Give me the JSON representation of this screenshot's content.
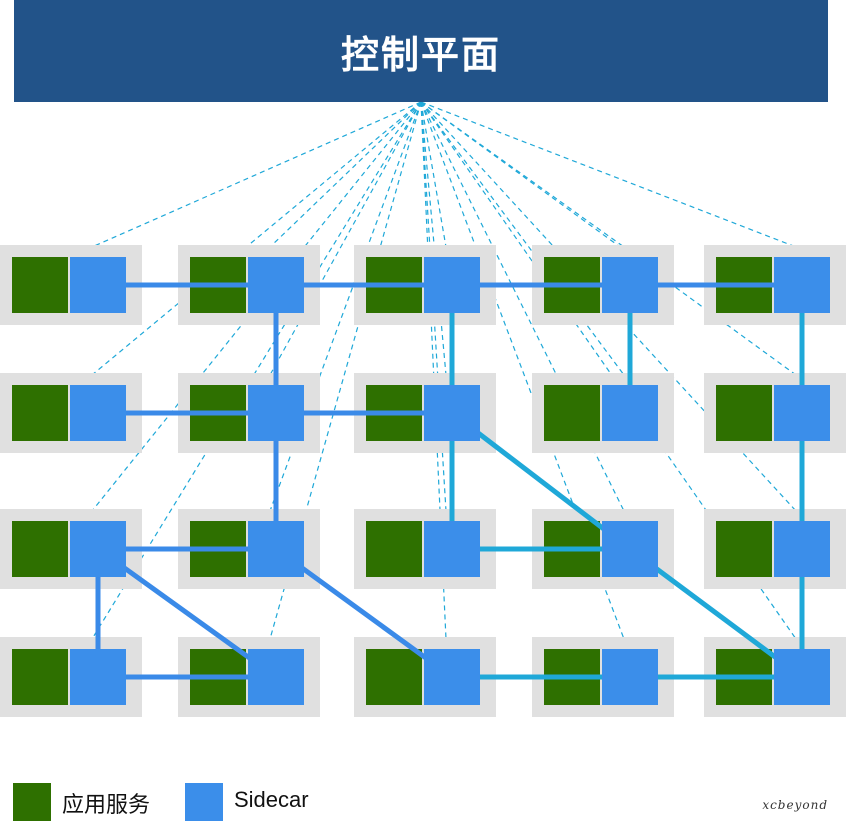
{
  "control_plane": {
    "label": "控制平面"
  },
  "colors": {
    "control_plane": "#225389",
    "app_service": "#2e7000",
    "sidecar": "#3b8eea",
    "node_bg": "#e0e0e0",
    "dark_link": "#3a8ae8",
    "teal_link": "#1fa8d8",
    "control_link": "#1fa8d8"
  },
  "grid": {
    "rows": 4,
    "cols": 5
  },
  "links": [
    {
      "from": [
        0,
        0
      ],
      "to": [
        0,
        1
      ],
      "style": "dark"
    },
    {
      "from": [
        0,
        1
      ],
      "to": [
        0,
        2
      ],
      "style": "dark"
    },
    {
      "from": [
        0,
        2
      ],
      "to": [
        0,
        3
      ],
      "style": "dark"
    },
    {
      "from": [
        0,
        3
      ],
      "to": [
        0,
        4
      ],
      "style": "dark"
    },
    {
      "from": [
        0,
        1
      ],
      "to": [
        1,
        1
      ],
      "style": "dark"
    },
    {
      "from": [
        0,
        2
      ],
      "to": [
        1,
        2
      ],
      "style": "teal"
    },
    {
      "from": [
        0,
        3
      ],
      "to": [
        1,
        3
      ],
      "style": "teal"
    },
    {
      "from": [
        0,
        4
      ],
      "to": [
        1,
        4
      ],
      "style": "teal"
    },
    {
      "from": [
        1,
        0
      ],
      "to": [
        1,
        1
      ],
      "style": "dark"
    },
    {
      "from": [
        1,
        1
      ],
      "to": [
        1,
        2
      ],
      "style": "dark"
    },
    {
      "from": [
        1,
        1
      ],
      "to": [
        2,
        1
      ],
      "style": "dark"
    },
    {
      "from": [
        1,
        2
      ],
      "to": [
        2,
        2
      ],
      "style": "teal"
    },
    {
      "from": [
        1,
        2
      ],
      "to": [
        2,
        3
      ],
      "style": "teal"
    },
    {
      "from": [
        1,
        4
      ],
      "to": [
        2,
        4
      ],
      "style": "teal"
    },
    {
      "from": [
        2,
        0
      ],
      "to": [
        2,
        1
      ],
      "style": "dark"
    },
    {
      "from": [
        2,
        2
      ],
      "to": [
        2,
        3
      ],
      "style": "teal"
    },
    {
      "from": [
        2,
        0
      ],
      "to": [
        3,
        0
      ],
      "style": "dark"
    },
    {
      "from": [
        2,
        0
      ],
      "to": [
        3,
        1
      ],
      "style": "dark"
    },
    {
      "from": [
        2,
        1
      ],
      "to": [
        3,
        2
      ],
      "style": "dark"
    },
    {
      "from": [
        2,
        3
      ],
      "to": [
        3,
        4
      ],
      "style": "teal"
    },
    {
      "from": [
        2,
        4
      ],
      "to": [
        3,
        4
      ],
      "style": "teal"
    },
    {
      "from": [
        3,
        0
      ],
      "to": [
        3,
        1
      ],
      "style": "dark"
    },
    {
      "from": [
        3,
        2
      ],
      "to": [
        3,
        3
      ],
      "style": "teal"
    },
    {
      "from": [
        3,
        3
      ],
      "to": [
        3,
        4
      ],
      "style": "teal"
    }
  ],
  "legend": {
    "app_label": "应用服务",
    "sidecar_label": "Sidecar"
  },
  "watermark": "xcbeyond"
}
